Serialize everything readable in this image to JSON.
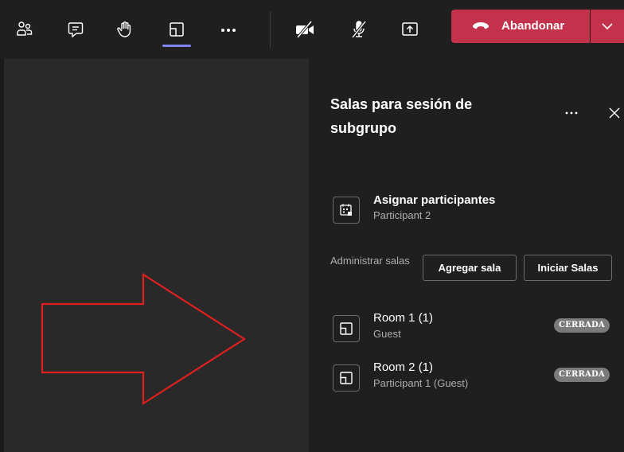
{
  "toolbar": {
    "icons": [
      "people-icon",
      "chat-icon",
      "raise-hand-icon",
      "breakout-rooms-icon",
      "more-icon",
      "camera-off-icon",
      "mic-off-icon",
      "share-screen-icon"
    ],
    "leave_label": "Abandonar",
    "leave_color": "#c4314b",
    "active_indicator_color": "#7f85f5"
  },
  "panel": {
    "title": "Salas para sesión de subgrupo",
    "assign": {
      "title": "Asignar participantes",
      "subtitle": "Participant 2"
    },
    "manage_label": "Administrar salas",
    "add_room_label": "Agregar sala",
    "start_rooms_label": "Iniciar Salas",
    "rooms": [
      {
        "name": "Room 1 (1)",
        "subtitle": "Guest",
        "status": "CERRADA"
      },
      {
        "name": "Room 2 (1)",
        "subtitle": "Participant 1 (Guest)",
        "status": "CERRADA"
      }
    ]
  },
  "annotation": {
    "arrow_color": "#e02020"
  }
}
